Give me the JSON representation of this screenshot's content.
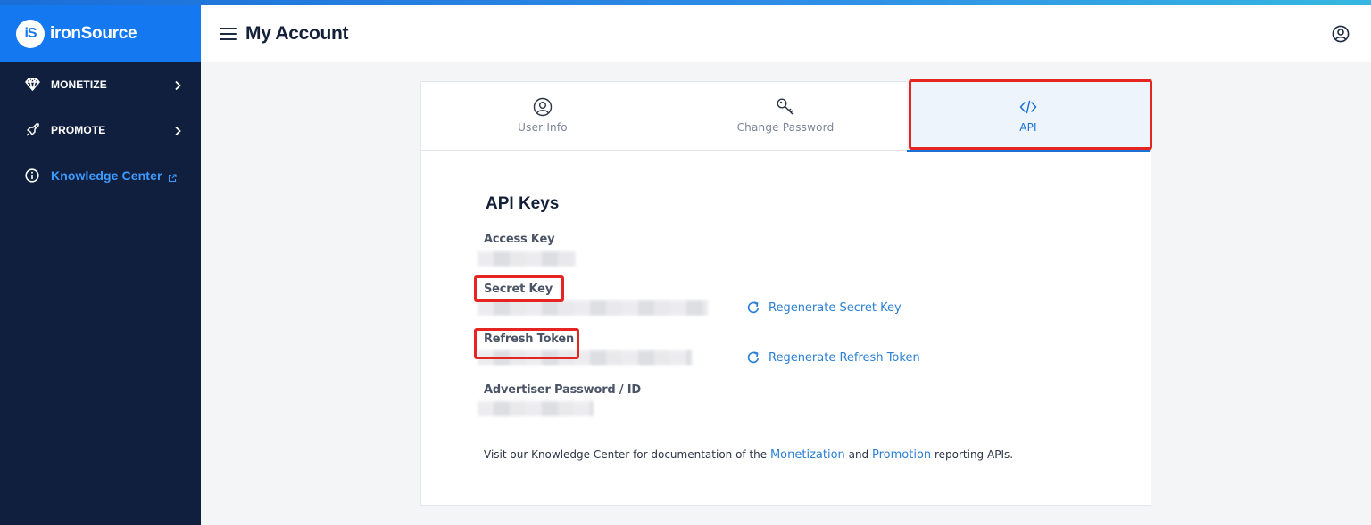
{
  "brand": {
    "mark": "iS",
    "name": "ironSource"
  },
  "sidebar": {
    "items": [
      {
        "label": "MONETIZE",
        "icon": "diamond-icon"
      },
      {
        "label": "PROMOTE",
        "icon": "rocket-icon"
      },
      {
        "label": "Knowledge Center",
        "icon": "info-icon"
      }
    ]
  },
  "header": {
    "title": "My Account"
  },
  "tabs": [
    {
      "label": "User Info",
      "icon": "user-circle-icon"
    },
    {
      "label": "Change Password",
      "icon": "key-icon"
    },
    {
      "label": "API",
      "icon": "code-icon",
      "active": true
    }
  ],
  "api": {
    "title": "API Keys",
    "access_key_label": "Access Key",
    "secret_key_label": "Secret Key",
    "refresh_token_label": "Refresh Token",
    "advertiser_label": "Advertiser Password / ID",
    "regenerate_secret": "Regenerate Secret Key",
    "regenerate_refresh": "Regenerate Refresh Token",
    "footnote_pre": "Visit our Knowledge Center for documentation of the ",
    "footnote_link1": "Monetization",
    "footnote_mid": " and ",
    "footnote_link2": "Promotion",
    "footnote_post": " reporting APIs."
  },
  "colors": {
    "accent": "#1478f0",
    "sidebar": "#0f1f3d",
    "highlight": "#e52521",
    "link": "#2a7fd4"
  }
}
